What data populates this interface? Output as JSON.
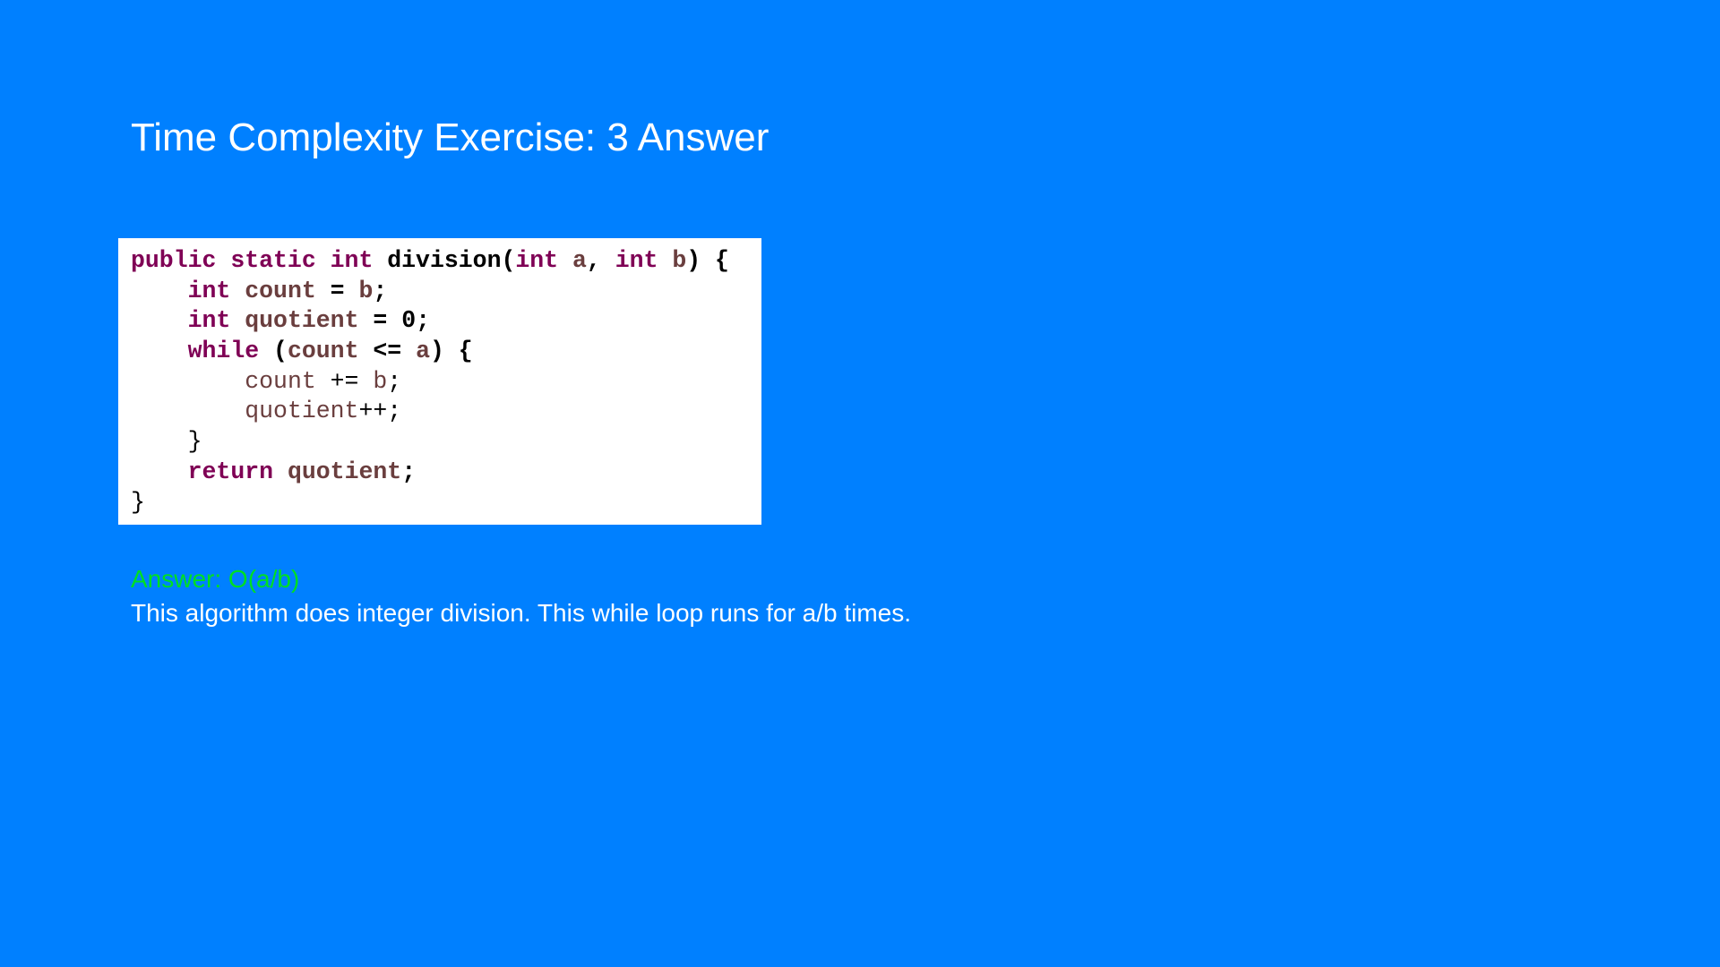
{
  "slide": {
    "title": "Time Complexity Exercise: 3 Answer",
    "background_color": "#0080FF"
  },
  "code": {
    "lines": [
      [
        {
          "text": "public static int ",
          "style": "kw"
        },
        {
          "text": "division(",
          "style": "plain"
        },
        {
          "text": "int ",
          "style": "kw"
        },
        {
          "text": "a",
          "style": "var"
        },
        {
          "text": ", ",
          "style": "plain"
        },
        {
          "text": "int ",
          "style": "kw"
        },
        {
          "text": "b",
          "style": "var"
        },
        {
          "text": ") {",
          "style": "plain"
        }
      ],
      [
        {
          "text": "    ",
          "style": "plain"
        },
        {
          "text": "int ",
          "style": "kw"
        },
        {
          "text": "count",
          "style": "var"
        },
        {
          "text": " = ",
          "style": "plain"
        },
        {
          "text": "b",
          "style": "var"
        },
        {
          "text": ";",
          "style": "plain"
        }
      ],
      [
        {
          "text": "    ",
          "style": "plain"
        },
        {
          "text": "int ",
          "style": "kw"
        },
        {
          "text": "quotient",
          "style": "var"
        },
        {
          "text": " = 0;",
          "style": "plain"
        }
      ],
      [
        {
          "text": "    ",
          "style": "plain"
        },
        {
          "text": "while",
          "style": "kw"
        },
        {
          "text": " (",
          "style": "plain"
        },
        {
          "text": "count",
          "style": "var"
        },
        {
          "text": " <= ",
          "style": "plain"
        },
        {
          "text": "a",
          "style": "var"
        },
        {
          "text": ") {",
          "style": "plain"
        }
      ],
      [
        {
          "text": "        ",
          "style": "plain-n"
        },
        {
          "text": "count",
          "style": "var-n"
        },
        {
          "text": " += ",
          "style": "plain-n"
        },
        {
          "text": "b",
          "style": "var-n"
        },
        {
          "text": ";",
          "style": "plain-n"
        }
      ],
      [
        {
          "text": "        ",
          "style": "plain-n"
        },
        {
          "text": "quotient",
          "style": "var-n"
        },
        {
          "text": "++;",
          "style": "plain-n"
        }
      ],
      [
        {
          "text": "    }",
          "style": "plain-n"
        }
      ],
      [
        {
          "text": "    ",
          "style": "plain"
        },
        {
          "text": "return",
          "style": "kw"
        },
        {
          "text": " ",
          "style": "plain"
        },
        {
          "text": "quotient",
          "style": "var"
        },
        {
          "text": ";",
          "style": "plain"
        }
      ],
      [
        {
          "text": "}",
          "style": "plain-n"
        }
      ]
    ]
  },
  "answer": {
    "label": "Answer: O(a/b)",
    "explanation": "This algorithm does integer division. This while loop runs for a/b times.",
    "label_color": "#00E020"
  }
}
